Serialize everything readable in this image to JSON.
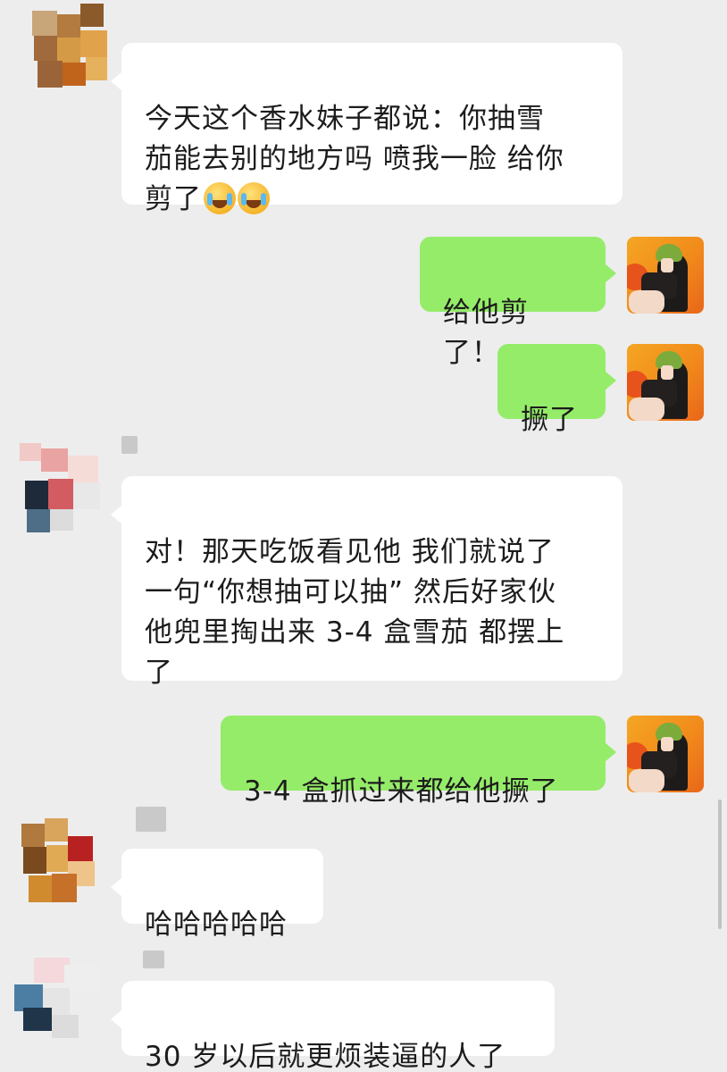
{
  "chat": {
    "messages": [
      {
        "side": "left",
        "text": "今天这个香水妹子都说：你抽雪\n茄能去别的地方吗 喷我一脸 给你\n剪了"
      },
      {
        "side": "right",
        "text": "给他剪了！"
      },
      {
        "side": "right",
        "text": "撅了"
      },
      {
        "side": "left",
        "text": "对！那天吃饭看见他 我们就说了\n一句“你想抽可以抽” 然后好家伙\n他兜里掏出来 3-4 盒雪茄 都摆上\n了"
      },
      {
        "side": "right",
        "text": "3-4 盒抓过来都给他撅了"
      },
      {
        "side": "left",
        "text": "哈哈哈哈哈"
      },
      {
        "side": "left",
        "text": "30 岁以后就更烦装逼的人了"
      }
    ],
    "emoji_icon": "loudly-crying-face-emoji",
    "colors": {
      "background": "#ededed",
      "incoming_bubble": "#ffffff",
      "outgoing_bubble": "#95ec69"
    }
  }
}
